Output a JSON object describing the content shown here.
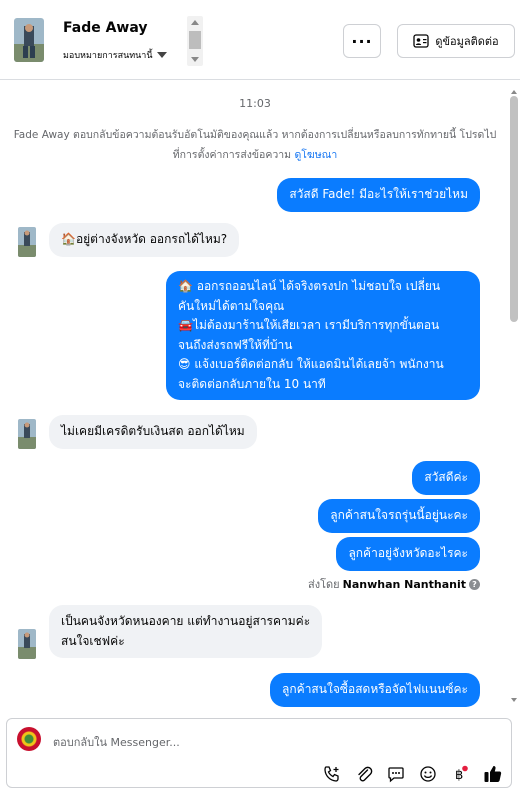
{
  "header": {
    "contact_name": "Fade Away",
    "assign_label": "มอบหมายการสนทนานี้",
    "more_label": "···",
    "contact_info_label": "ดูข้อมูลติดต่อ"
  },
  "chat": {
    "timestamp": "11:03",
    "system_message": "Fade Away ตอบกลับข้อความต้อนรับอัตโนมัติของคุณแล้ว หากต้องการเปลี่ยนหรือลบการทักทายนี้ โปรดไปที่การตั้งค่าการส่งข้อความ",
    "system_link": "ดูโฆษณา",
    "messages": [
      {
        "text": "สวัสดี Fade! มีอะไรให้เราช่วยไหม"
      },
      {
        "text": "🏠อยู่ต่างจังหวัด ออกรถได้ไหม?"
      },
      {
        "line1": "🏠 ออกรถออนไลน์ ได้จริงตรงปก ไม่ชอบใจ เปลี่ยน",
        "line2": "คันใหม่ได้ตามใจคุณ",
        "line3": "🚘ไม่ต้องมาร้านให้เสียเวลา เรามีบริการทุกขั้นตอน",
        "line4": "จนถึงส่งรถฟรีให้ที่บ้าน",
        "line5": "😎 แจ้งเบอร์ติดต่อกลับ ให้แอดมินได้เลยจ้า พนักงาน",
        "line6": "จะติดต่อกลับภายใน 10 นาที"
      },
      {
        "text": "ไม่เคยมีเครดิตรับเงินสด ออกได้ไหม"
      },
      {
        "text": "สวัสดีค่ะ"
      },
      {
        "text": "ลูกค้าสนใจรถรุ่นนี้อยู่นะคะ"
      },
      {
        "text": "ลูกค้าอยู่จังหวัดอะไรคะ"
      },
      {
        "line1": "เป็นคนจังหวัดหนองคาย แต่ทำงานอยู่สารคามค่ะ",
        "line2": "สนใจเชฟค่ะ"
      },
      {
        "text": "ลูกค้าสนใจซื้อสดหรือจัดไฟแนนซ์คะ"
      }
    ],
    "sent_by_prefix": "ส่งโดย",
    "sent_by_name": "Nanwhan Nanthanit",
    "info_glyph": "?"
  },
  "composer": {
    "placeholder": "ตอบกลับใน Messenger...",
    "tools": [
      "call-add-icon",
      "attach-icon",
      "quick-reply-icon",
      "emoji-icon",
      "payment-icon",
      "like-icon"
    ]
  },
  "colors": {
    "outgoing_bubble": "#0a7cff",
    "incoming_bubble": "#f0f2f5",
    "link": "#1877f2",
    "muted_text": "#65676b",
    "notification_dot": "#e41e3f"
  }
}
